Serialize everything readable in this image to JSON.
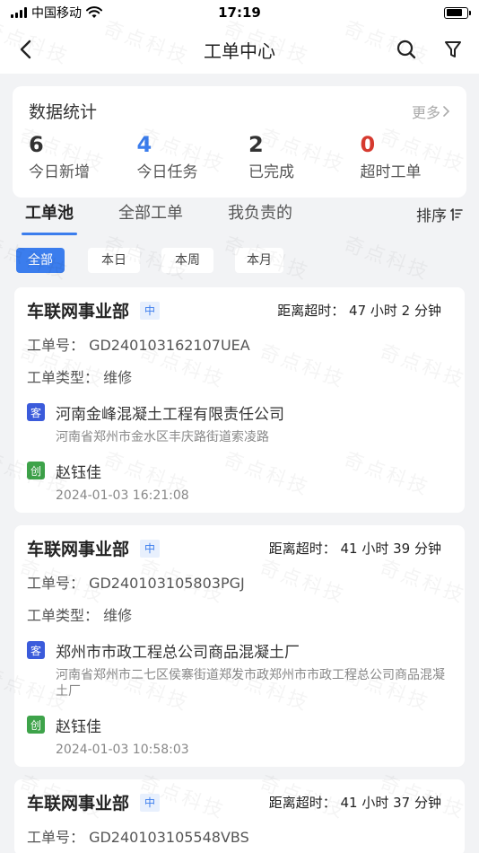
{
  "status_bar": {
    "carrier": "中国移动",
    "time": "17:19"
  },
  "nav": {
    "title": "工单中心"
  },
  "stats": {
    "title": "数据统计",
    "more": "更多",
    "items": [
      {
        "value": "6",
        "label": "今日新增",
        "color": "#333333"
      },
      {
        "value": "4",
        "label": "今日任务",
        "color": "#3b7ded"
      },
      {
        "value": "2",
        "label": "已完成",
        "color": "#333333"
      },
      {
        "value": "0",
        "label": "超时工单",
        "color": "#d63a2f"
      }
    ]
  },
  "tabs": [
    {
      "label": "工单池",
      "active": true
    },
    {
      "label": "全部工单",
      "active": false
    },
    {
      "label": "我负责的",
      "active": false
    }
  ],
  "sort_label": "排序",
  "filters": [
    {
      "label": "全部",
      "active": true
    },
    {
      "label": "本日",
      "active": false
    },
    {
      "label": "本周",
      "active": false
    },
    {
      "label": "本月",
      "active": false
    }
  ],
  "orders": [
    {
      "dept": "车联网事业部",
      "priority": "中",
      "timeout": "距离超时： 47 小时 2 分钟",
      "order_no": "工单号：  GD240103162107UEA",
      "type": "工单类型：  维修",
      "customer_badge": "客",
      "customer": "河南金峰混凝土工程有限责任公司",
      "address": "河南省郑州市金水区丰庆路街道索凌路",
      "creator_badge": "创",
      "creator": "赵钰佳",
      "created_at": "2024-01-03 16:21:08"
    },
    {
      "dept": "车联网事业部",
      "priority": "中",
      "timeout": "距离超时： 41 小时 39 分钟",
      "order_no": "工单号：  GD240103105803PGJ",
      "type": "工单类型：  维修",
      "customer_badge": "客",
      "customer": "郑州市市政工程总公司商品混凝土厂",
      "address": "河南省郑州市二七区侯寨街道郑发市政郑州市市政工程总公司商品混凝土厂",
      "creator_badge": "创",
      "creator": "赵钰佳",
      "created_at": "2024-01-03 10:58:03"
    },
    {
      "dept": "车联网事业部",
      "priority": "中",
      "timeout": "距离超时： 41 小时 37 分钟",
      "order_no": "工单号：  GD240103105548VBS"
    }
  ],
  "watermark": "奇点科技"
}
